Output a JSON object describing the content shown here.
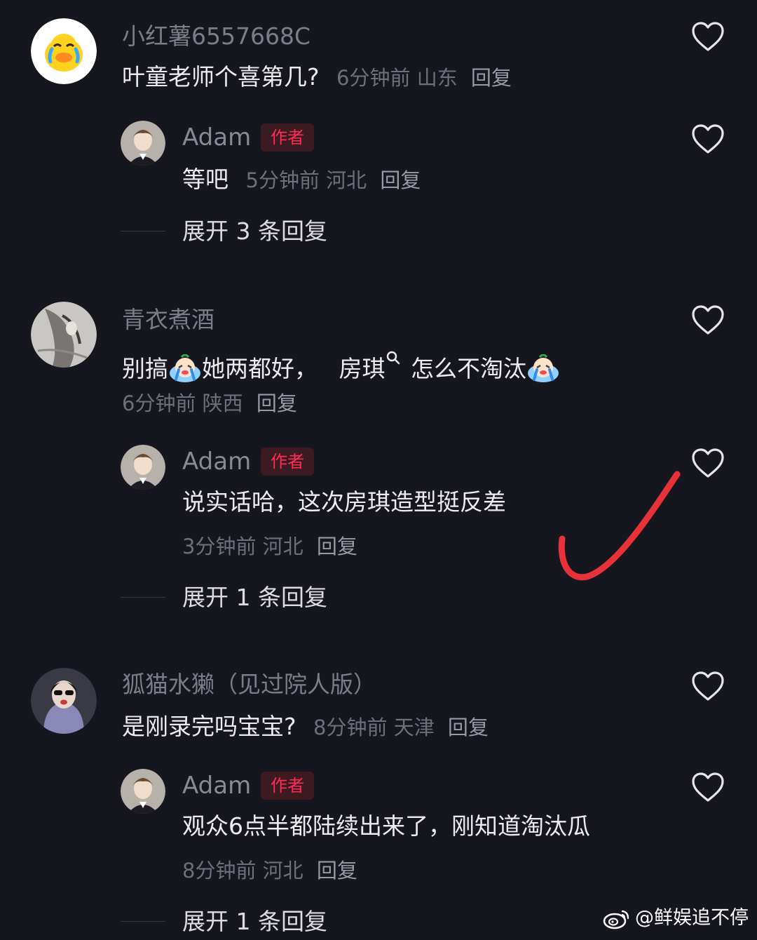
{
  "comments": [
    {
      "user": "小红薯6557668C",
      "text": "叶童老师个喜第几?",
      "meta": {
        "time": "6分钟前",
        "location": "山东",
        "reply": "回复"
      },
      "reply": {
        "user": "Adam",
        "badge": "作者",
        "text": "等吧",
        "meta": {
          "time": "5分钟前",
          "location": "河北",
          "reply": "回复"
        },
        "expand": "展开 3 条回复"
      }
    },
    {
      "user": "青衣煮酒",
      "text_parts": [
        "别搞",
        "她两都好，",
        "房琪",
        "怎么不淘汰"
      ],
      "meta": {
        "time": "6分钟前",
        "location": "陕西",
        "reply": "回复"
      },
      "reply": {
        "user": "Adam",
        "badge": "作者",
        "text": "说实话哈，这次房琪造型挺反差",
        "meta": {
          "time": "3分钟前",
          "location": "河北",
          "reply": "回复"
        },
        "expand": "展开 1 条回复"
      }
    },
    {
      "user": "狐猫水獭（见过院人版）",
      "text": "是刚录完吗宝宝?",
      "meta": {
        "time": "8分钟前",
        "location": "天津",
        "reply": "回复"
      },
      "reply": {
        "user": "Adam",
        "badge": "作者",
        "text": "观众6点半都陆续出来了，刚知道淘汰瓜",
        "meta": {
          "time": "8分钟前",
          "location": "河北",
          "reply": "回复"
        },
        "expand": "展开 1 条回复"
      }
    }
  ],
  "watermark": "@鲜娱追不停",
  "icons": {
    "like": "heart-outline-icon",
    "emoji": "crying-emoji",
    "search": "search-icon",
    "annotation": "red-checkmark"
  },
  "colors": {
    "background": "#16161f",
    "author_badge": "#ff2c55",
    "checkmark": "#e8323a"
  }
}
